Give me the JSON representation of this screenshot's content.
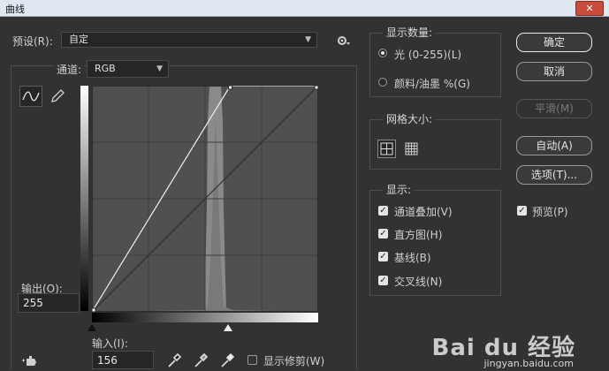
{
  "window": {
    "title": "曲线",
    "close_label": "✕"
  },
  "preset": {
    "label": "预设(R):",
    "value": "自定"
  },
  "channel": {
    "label": "通道:",
    "value": "RGB"
  },
  "curve": {
    "input_label": "输入(I):",
    "input_value": "156",
    "output_label": "输出(O):",
    "output_value": "255",
    "show_clipping_label": "显示修剪(W)",
    "show_clipping_checked": false,
    "points": [
      [
        0,
        0
      ],
      [
        156,
        255
      ],
      [
        255,
        255
      ]
    ]
  },
  "display_amount": {
    "title": "显示数量:",
    "options": [
      {
        "label": "光 (0-255)(L)",
        "selected": true
      },
      {
        "label": "颜料/油墨 %(G)",
        "selected": false
      }
    ]
  },
  "grid_size": {
    "title": "网格大小:"
  },
  "show": {
    "title": "显示:",
    "options": [
      {
        "label": "通道叠加(V)",
        "checked": true
      },
      {
        "label": "直方图(H)",
        "checked": true
      },
      {
        "label": "基线(B)",
        "checked": true
      },
      {
        "label": "交叉线(N)",
        "checked": true
      }
    ]
  },
  "buttons": {
    "ok": "确定",
    "cancel": "取消",
    "smooth": "平滑(M)",
    "auto": "自动(A)",
    "options": "选项(T)..."
  },
  "preview": {
    "label": "预览(P)",
    "checked": true
  },
  "watermark": {
    "brand": "Bai du 经验",
    "url": "jingyan.baidu.com"
  }
}
